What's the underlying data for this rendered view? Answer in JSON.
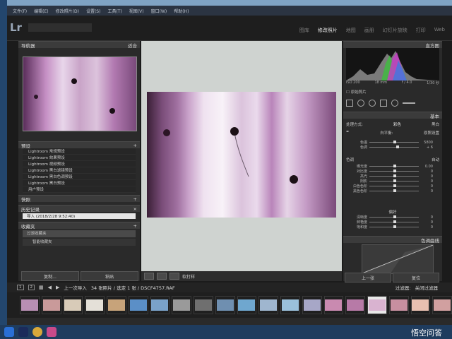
{
  "app": {
    "logo": "Lr"
  },
  "menubar": [
    "文件(F)",
    "编辑(E)",
    "修改照片(D)",
    "设置(S)",
    "工具(T)",
    "视图(V)",
    "窗口(W)",
    "帮助(H)"
  ],
  "modules": [
    "图库",
    "修改照片",
    "地图",
    "画册",
    "幻灯片放映",
    "打印",
    "Web"
  ],
  "left": {
    "navigator": "导航器",
    "nav_fit": "适合",
    "presets_header": "预设",
    "presets": [
      "Lightroom 常规预设",
      "Lightroom 效果预设",
      "Lightroom 视频预设",
      "Lightroom 黑白滤镜预设",
      "Lightroom 黑白色调预设",
      "Lightroom 黑白预设",
      "用户预设"
    ],
    "snapshots": "快照",
    "history": "历史记录",
    "history_item": "导入 (2018/2/28 9:52:40)",
    "collections": "收藏夹",
    "coll_items": [
      "过滤收藏夹",
      "智能收藏夹"
    ],
    "copy_btn": "复制...",
    "paste_btn": "粘贴"
  },
  "center": {
    "softproof": "软打样"
  },
  "right": {
    "histogram_label": "直方图",
    "info": [
      "ISO 200",
      "18 mm",
      "f / 4.0",
      "1/30 秒"
    ],
    "original_photo": "原始照片",
    "basic": "基本",
    "treatment": "处理方式:",
    "color": "彩色",
    "bw": "黑白",
    "wb": "白平衡:",
    "wb_value": "原照设置",
    "tone": "色调",
    "auto": "自动",
    "presence": "偏好",
    "tone_curve": "色调曲线",
    "prev_btn": "上一张",
    "reset_btn": "复位",
    "sliders": [
      {
        "label": "色温",
        "value": "5800"
      },
      {
        "label": "色调",
        "value": "+ 6"
      },
      {
        "label": "曝光度",
        "value": "0.00"
      },
      {
        "label": "对比度",
        "value": "0"
      },
      {
        "label": "高光",
        "value": "0"
      },
      {
        "label": "阴影",
        "value": "0"
      },
      {
        "label": "白色色阶",
        "value": "0"
      },
      {
        "label": "黑色色阶",
        "value": "0"
      },
      {
        "label": "清晰度",
        "value": "0"
      },
      {
        "label": "鲜艳度",
        "value": "0"
      },
      {
        "label": "饱和度",
        "value": "0"
      }
    ]
  },
  "filmstrip": {
    "pages": [
      "1",
      "2"
    ],
    "source": "上一次导入",
    "info": "34 张照片 / 选定 1 张 / DSCF4757.RAF",
    "filter_label": "过滤器:",
    "filter_value": "关闭过滤器"
  },
  "watermark": "悟空问答"
}
